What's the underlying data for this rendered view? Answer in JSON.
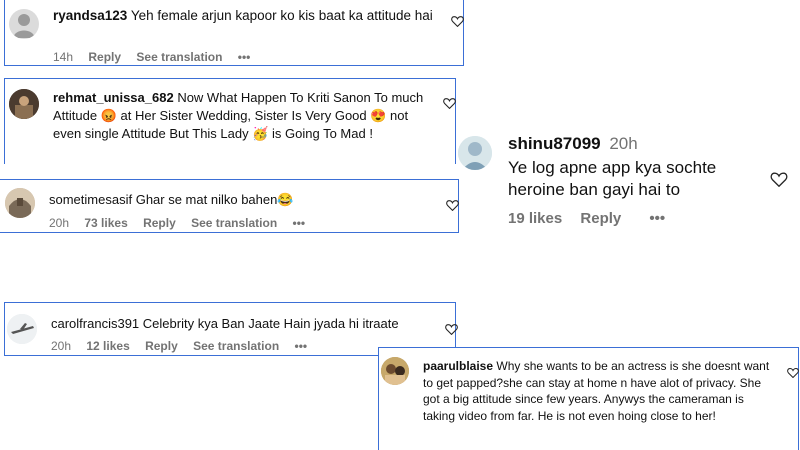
{
  "comments": [
    {
      "username": "ryandsa123",
      "text": "Yeh female arjun kapoor ko kis baat ka attitude hai",
      "age": "14h",
      "reply": "Reply",
      "translate": "See translation",
      "more": "•••",
      "icon": "default-avatar-icon"
    },
    {
      "username": "rehmat_unissa_682",
      "text": "Now What Happen To Kriti Sanon To much Attitude 😡 at Her Sister Wedding, Sister Is Very Good 😍 not even single Attitude But This Lady 🥳 is Going To Mad !",
      "icon": "avatar-photo"
    },
    {
      "username": "sometimesasif",
      "text": "Ghar se mat nilko bahen😂",
      "age": "20h",
      "likes": "73 likes",
      "reply": "Reply",
      "translate": "See translation",
      "more": "•••",
      "icon": "avatar-photo"
    },
    {
      "username": "shinu87099",
      "age": "20h",
      "text": "Ye log apne app kya sochte heroine ban gayi hai to",
      "likes": "19 likes",
      "reply": "Reply",
      "more": "•••",
      "icon": "avatar-photo"
    },
    {
      "username": "carolfrancis391",
      "text": "Celebrity kya Ban Jaate Hain jyada hi itraate",
      "age": "20h",
      "likes": "12 likes",
      "reply": "Reply",
      "translate": "See translation",
      "more": "•••",
      "icon": "avatar-photo"
    },
    {
      "username": "paarulblaise",
      "text": "Why she wants to be an actress is she doesnt want to get papped?she can stay at home n have alot of privacy. She got a big attitude since few years. Anywys the cameraman is taking video from far. He is not even hoing close to her!",
      "icon": "avatar-photo"
    }
  ],
  "colors": {
    "border": "#3b6fd6",
    "muted": "#737373",
    "text": "#111111"
  }
}
